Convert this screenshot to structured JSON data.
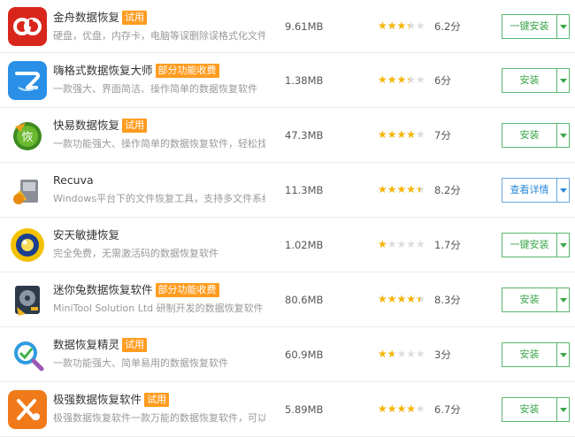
{
  "apps": [
    {
      "name": "金舟数据恢复",
      "tag": "试用",
      "desc": "硬盘，优盘，内存卡，电脑等误删除误格式化文件...",
      "size": "9.61MB",
      "rating": 3,
      "score": "6.2分",
      "action": "一键安装",
      "icon": "jinzhou-logo-icon",
      "action_style": "green"
    },
    {
      "name": "嗨格式数据恢复大师",
      "tag": "部分功能收费",
      "desc": "一款强大、界面简洁、操作简单的数据恢复软件",
      "size": "1.38MB",
      "rating": 3,
      "score": "6分",
      "action": "安装",
      "icon": "hgs-logo-icon",
      "action_style": "green"
    },
    {
      "name": "快易数据恢复",
      "tag": "试用",
      "desc": "一款功能强大、操作简单的数据恢复软件，轻松找...",
      "size": "47.3MB",
      "rating": 3.5,
      "score": "7分",
      "action": "安装",
      "icon": "kuaiyi-logo-icon",
      "action_style": "green"
    },
    {
      "name": "Recuva",
      "tag": "",
      "desc": "Windows平台下的文件恢复工具，支持多文件系统",
      "size": "11.3MB",
      "rating": 4,
      "score": "8.2分",
      "action": "查看详情",
      "icon": "recuva-logo-icon",
      "action_style": "blue"
    },
    {
      "name": "安天敏捷恢复",
      "tag": "",
      "desc": "完全免费，无需激活码的数据恢复软件",
      "size": "1.02MB",
      "rating": 1,
      "score": "1.7分",
      "action": "一键安装",
      "icon": "antian-logo-icon",
      "action_style": "green"
    },
    {
      "name": "迷你兔数据恢复软件",
      "tag": "部分功能收费",
      "desc": "MiniTool Solution Ltd 研制开发的数据恢复软件",
      "size": "80.6MB",
      "rating": 4,
      "score": "8.3分",
      "action": "安装",
      "icon": "minitool-logo-icon",
      "action_style": "green"
    },
    {
      "name": "数据恢复精灵",
      "tag": "试用",
      "desc": "一款功能强大、简单易用的数据恢复软件",
      "size": "60.9MB",
      "rating": 1.5,
      "score": "3分",
      "action": "安装",
      "icon": "jingling-logo-icon",
      "action_style": "green"
    },
    {
      "name": "极强数据恢复软件",
      "tag": "试用",
      "desc": "极强数据恢复软件一款万能的数据恢复软件，可以...",
      "size": "5.89MB",
      "rating": 3.5,
      "score": "6.7分",
      "action": "安装",
      "icon": "jiqiang-logo-icon",
      "action_style": "green"
    }
  ]
}
